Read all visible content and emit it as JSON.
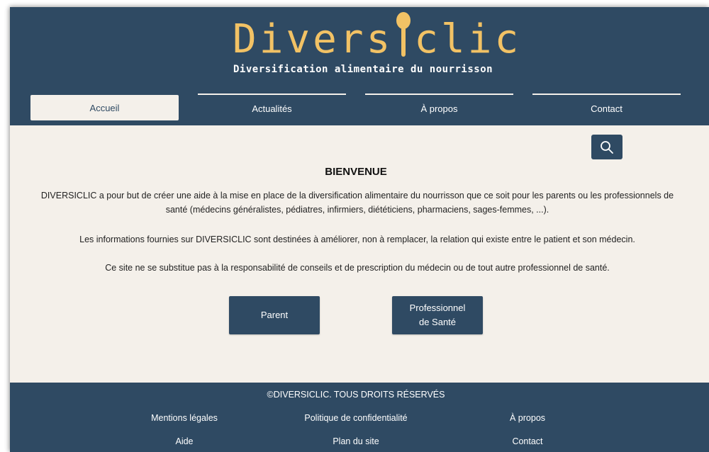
{
  "brand": {
    "logo_before": "Divers",
    "logo_after": "clic",
    "tagline": "Diversification alimentaire du nourrisson",
    "logo_color": "#f2c265"
  },
  "colors": {
    "primary": "#2f4a63",
    "background": "#f4f0ea",
    "text_on_primary": "#ffffff"
  },
  "nav": {
    "active": "Accueil",
    "items": [
      {
        "label": "Accueil"
      },
      {
        "label": "Actualités"
      },
      {
        "label": "À propos"
      },
      {
        "label": "Contact"
      }
    ]
  },
  "search": {
    "icon": "search-icon"
  },
  "main": {
    "title": "BIENVENUE",
    "paragraphs": [
      "DIVERSICLIC a pour but de créer une aide à la mise en place de la diversification alimentaire du nourrisson que ce soit pour les parents ou les professionnels de santé (médecins généralistes, pédiatres, infirmiers, diététiciens, pharmaciens, sages-femmes, ...).",
      "Les informations fournies sur DIVERSICLIC sont destinées à améliorer, non à remplacer, la relation qui existe entre le patient et son médecin.",
      "Ce site ne se substitue pas à la responsabilité de conseils et de prescription du médecin ou de tout autre professionnel de santé."
    ],
    "buttons": {
      "parent": "Parent",
      "pro_line1": "Professionnel",
      "pro_line2": "de Santé"
    }
  },
  "footer": {
    "copyright": "©DIVERSICLIC. TOUS DROITS RÉSERVÉS",
    "links": [
      "Mentions légales",
      "Politique de confidentialité",
      "À propos",
      "Aide",
      "Plan du site",
      "Contact"
    ]
  }
}
